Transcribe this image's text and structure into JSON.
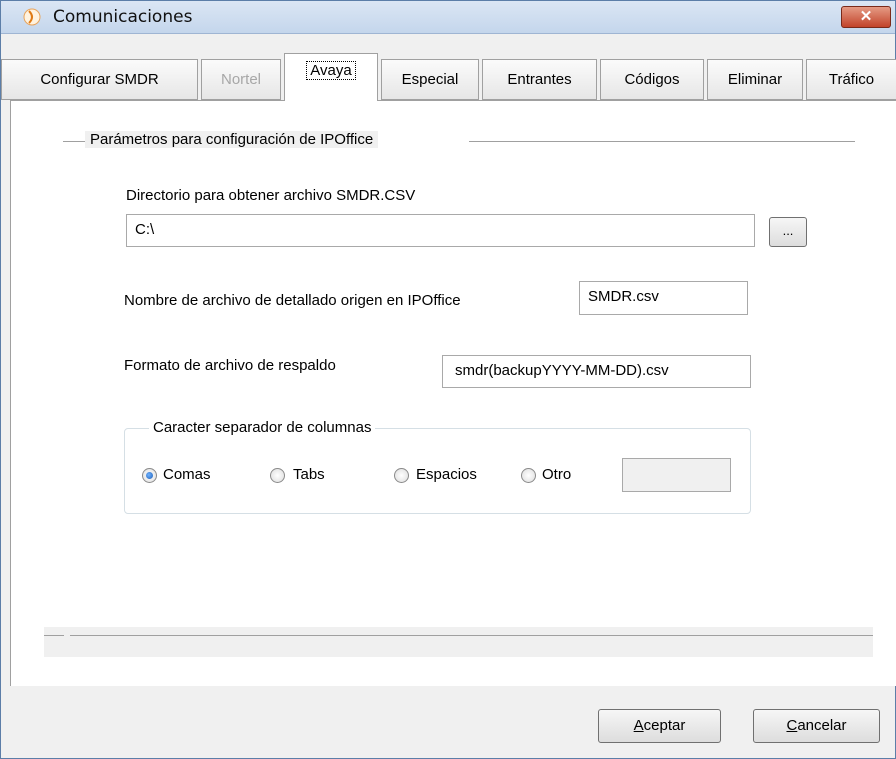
{
  "window": {
    "title": "Comunicaciones",
    "close_label": "✕"
  },
  "tabs": [
    {
      "label": "Configurar SMDR",
      "state": "normal"
    },
    {
      "label": "Nortel",
      "state": "disabled"
    },
    {
      "label": "Avaya",
      "state": "active"
    },
    {
      "label": "Especial",
      "state": "normal"
    },
    {
      "label": "Entrantes",
      "state": "normal"
    },
    {
      "label": "Códigos",
      "state": "normal"
    },
    {
      "label": "Eliminar",
      "state": "normal"
    },
    {
      "label": "Tráfico",
      "state": "normal"
    }
  ],
  "group": {
    "legend": "Parámetros para configuración de IPOffice"
  },
  "directory": {
    "label": "Directorio para obtener archivo SMDR.CSV",
    "value": "C:\\",
    "browse_label": "..."
  },
  "source_file": {
    "label": "Nombre de archivo de detallado origen en IPOffice",
    "value": "SMDR.csv"
  },
  "backup_format": {
    "label": "Formato de archivo de respaldo",
    "value": "smdr(backupYYYY-MM-DD).csv"
  },
  "separator": {
    "legend": "Caracter separador de columnas",
    "options": [
      {
        "label": "Comas",
        "checked": true
      },
      {
        "label": "Tabs",
        "checked": false
      },
      {
        "label": "Espacios",
        "checked": false
      },
      {
        "label": "Otro",
        "checked": false
      }
    ],
    "otro_value": ""
  },
  "buttons": {
    "accept_mnemonic": "A",
    "accept_rest": "ceptar",
    "cancel_mnemonic": "C",
    "cancel_rest": "ancelar"
  },
  "colors": {
    "title_gradient_top": "#dbe6f4",
    "close_button": "#c2432a",
    "radio_checked": "#1f5fb6"
  }
}
